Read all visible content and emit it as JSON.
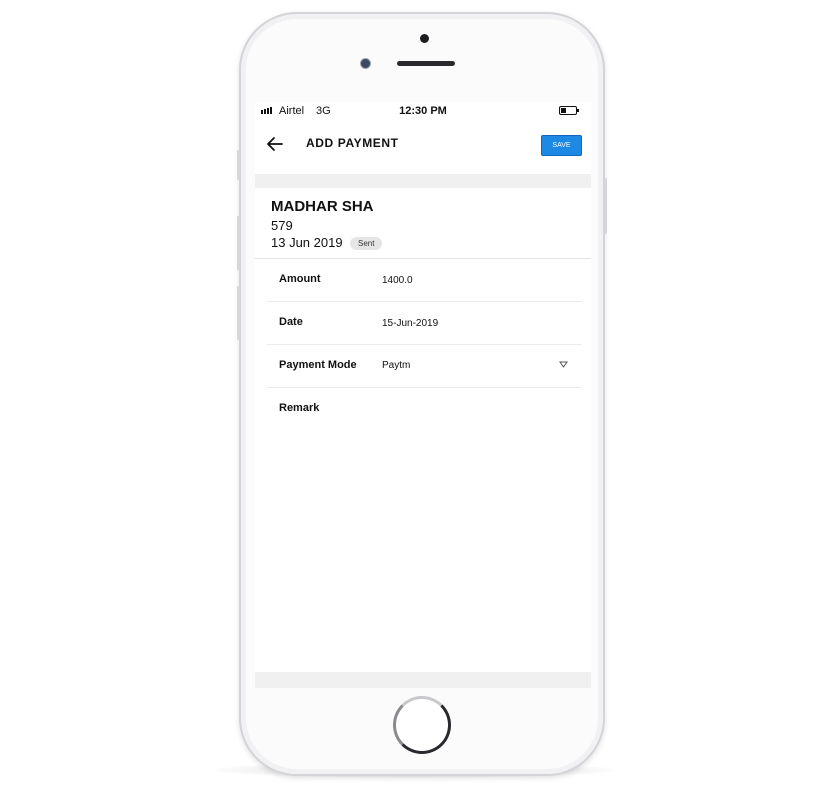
{
  "status_bar": {
    "carrier": "Airtel",
    "network": "3G",
    "time": "12:30 PM",
    "icons": [
      "signal-bars-icon",
      "battery-icon"
    ]
  },
  "app_bar": {
    "back_icon": "arrow-left-icon",
    "title": "ADD PAYMENT",
    "save_label": "SAVE",
    "save_color": "#1e88e5"
  },
  "customer": {
    "name": "MADHAR SHA",
    "number": "579",
    "date": "13 Jun 2019",
    "status": "Sent"
  },
  "form": {
    "amount": {
      "label": "Amount",
      "value": "1400.0"
    },
    "date": {
      "label": "Date",
      "value": "15-Jun-2019"
    },
    "payment_mode": {
      "label": "Payment Mode",
      "value": "Paytm",
      "icon": "dropdown-triangle-icon"
    },
    "remark": {
      "label": "Remark",
      "value": ""
    }
  }
}
